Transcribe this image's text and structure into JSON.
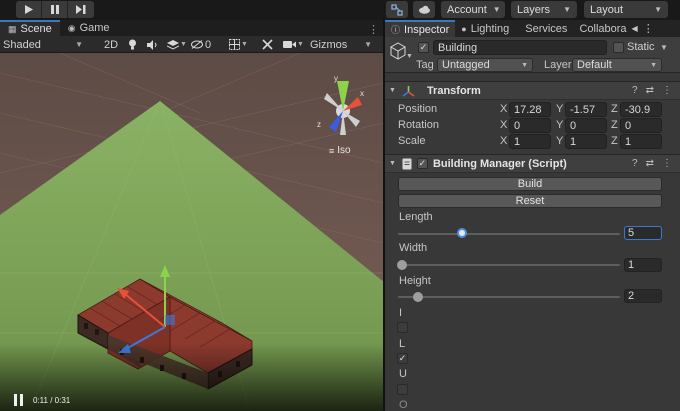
{
  "toolbar": {
    "account_label": "Account",
    "layers_label": "Layers",
    "layout_label": "Layout"
  },
  "scene": {
    "tabs": [
      {
        "label": "Scene"
      },
      {
        "label": "Game"
      }
    ],
    "shading_mode": "Shaded",
    "twod_label": "2D",
    "hidden_count": "0",
    "gizmos_label": "Gizmos",
    "projection_label": "Iso",
    "video_time": "0:11 / 0:31",
    "grid_colors": {
      "ground": "#7ea35a",
      "sky_top": "#5d4b45",
      "sky_bottom": "#7b6158"
    }
  },
  "inspector": {
    "tabs": [
      {
        "label": "Inspector"
      },
      {
        "label": "Lighting"
      },
      {
        "label": "Services"
      },
      {
        "label": "Collabora"
      }
    ],
    "object": {
      "name": "Building",
      "active": true,
      "static_label": "Static",
      "tag_label": "Tag",
      "tag_value": "Untagged",
      "layer_label": "Layer",
      "layer_value": "Default"
    },
    "transform": {
      "title": "Transform",
      "rows": [
        {
          "label": "Position",
          "x": "17.28",
          "y": "-1.57",
          "z": "-30.9"
        },
        {
          "label": "Rotation",
          "x": "0",
          "y": "0",
          "z": "0"
        },
        {
          "label": "Scale",
          "x": "1",
          "y": "1",
          "z": "1"
        }
      ],
      "axes": {
        "x": "X",
        "y": "Y",
        "z": "Z"
      }
    },
    "building_manager": {
      "title": "Building Manager (Script)",
      "enabled": true,
      "build_label": "Build",
      "reset_label": "Reset",
      "sliders": [
        {
          "label": "Length",
          "value": "5",
          "fraction": 0.27
        },
        {
          "label": "Width",
          "value": "1",
          "fraction": 0.0
        },
        {
          "label": "Height",
          "value": "2",
          "fraction": 0.07
        }
      ],
      "bools": [
        {
          "label": "I",
          "checked": false
        },
        {
          "label": "L",
          "checked": true
        },
        {
          "label": "U",
          "checked": false
        },
        {
          "label": "O",
          "checked": false
        }
      ]
    }
  }
}
